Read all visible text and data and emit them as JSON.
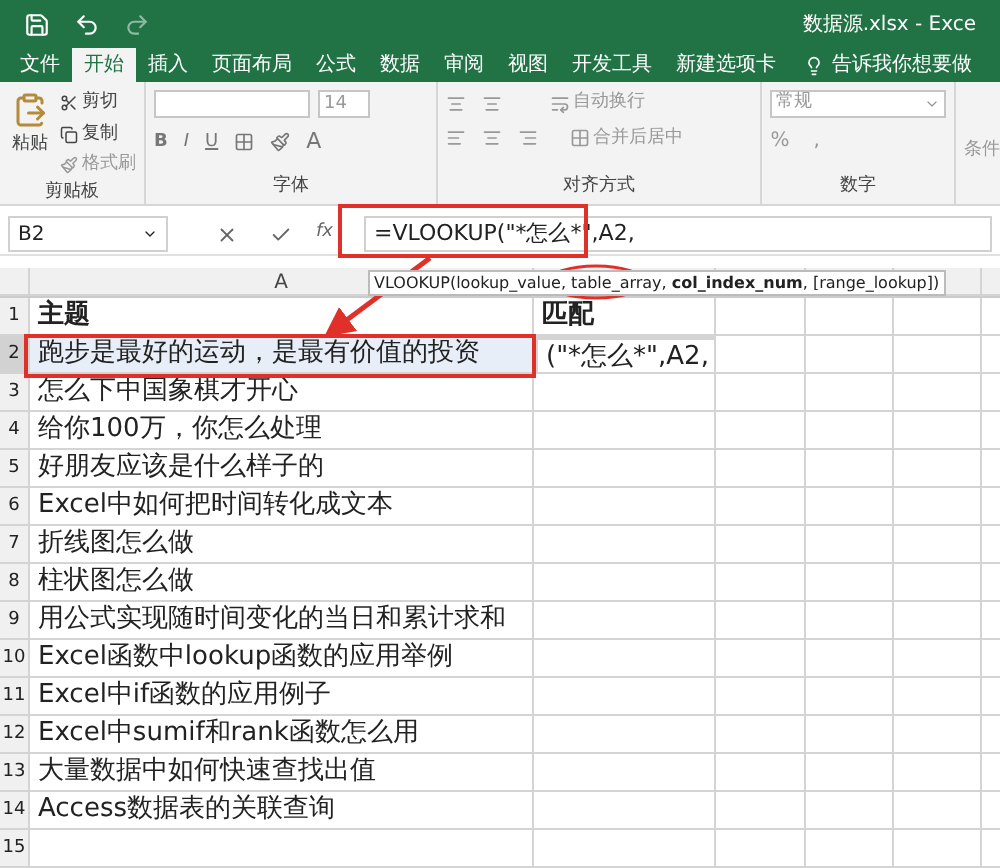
{
  "title_bar": {
    "title": "数据源.xlsx - Exce"
  },
  "tabs": [
    {
      "label": "文件",
      "selected": false
    },
    {
      "label": "开始",
      "selected": true
    },
    {
      "label": "插入",
      "selected": false
    },
    {
      "label": "页面布局",
      "selected": false
    },
    {
      "label": "公式",
      "selected": false
    },
    {
      "label": "数据",
      "selected": false
    },
    {
      "label": "审阅",
      "selected": false
    },
    {
      "label": "视图",
      "selected": false
    },
    {
      "label": "开发工具",
      "selected": false
    },
    {
      "label": "新建选项卡",
      "selected": false
    }
  ],
  "tell_me": "告诉我你想要做",
  "ribbon": {
    "clipboard": {
      "paste": "粘贴",
      "cut": "剪切",
      "copy": "复制",
      "format_painter": "格式刷",
      "label": "剪贴板"
    },
    "font": {
      "size": "14",
      "bold": "B",
      "italic": "I",
      "underline": "U",
      "font_color_letter": "A",
      "label": "字体"
    },
    "alignment": {
      "wrap": "自动换行",
      "merge": "合并后居中",
      "label": "对齐方式"
    },
    "number": {
      "format": "常规",
      "percent": "%",
      "comma": ",",
      "label": "数字"
    },
    "styles": {
      "conditional": "条件"
    }
  },
  "formula_bar": {
    "name_box": "B2",
    "function_label": "fx",
    "formula": "=VLOOKUP(\"*怎么*\",A2,"
  },
  "tooltip": "VLOOKUP(lookup_value, table_array, **col_index_num**, [range_lookup])",
  "columns": [
    "A"
  ],
  "rows": [
    {
      "number": "1",
      "a": "主题",
      "b": "匹配",
      "header": true,
      "selected": false
    },
    {
      "number": "2",
      "a": "跑步是最好的运动，是最有价值的投资",
      "b": "(\"*怎么*\",A2,",
      "header": false,
      "selected": true
    },
    {
      "number": "3",
      "a": "怎么下中国象棋才开心",
      "header": false,
      "selected": false
    },
    {
      "number": "4",
      "a": "给你100万，你怎么处理",
      "header": false,
      "selected": false
    },
    {
      "number": "5",
      "a": "好朋友应该是什么样子的",
      "header": false,
      "selected": false
    },
    {
      "number": "6",
      "a": "Excel中如何把时间转化成文本",
      "header": false,
      "selected": false
    },
    {
      "number": "7",
      "a": "折线图怎么做",
      "header": false,
      "selected": false
    },
    {
      "number": "8",
      "a": "柱状图怎么做",
      "header": false,
      "selected": false
    },
    {
      "number": "9",
      "a": "用公式实现随时间变化的当日和累计求和",
      "header": false,
      "selected": false
    },
    {
      "number": "10",
      "a": "Excel函数中lookup函数的应用举例",
      "header": false,
      "selected": false
    },
    {
      "number": "11",
      "a": "Excel中if函数的应用例子",
      "header": false,
      "selected": false
    },
    {
      "number": "12",
      "a": "Excel中sumif和rank函数怎么用",
      "header": false,
      "selected": false
    },
    {
      "number": "13",
      "a": "大量数据中如何快速查找出值",
      "header": false,
      "selected": false
    },
    {
      "number": "14",
      "a": "Access数据表的关联查询",
      "header": false,
      "selected": false
    },
    {
      "number": "15",
      "selected": false
    }
  ]
}
